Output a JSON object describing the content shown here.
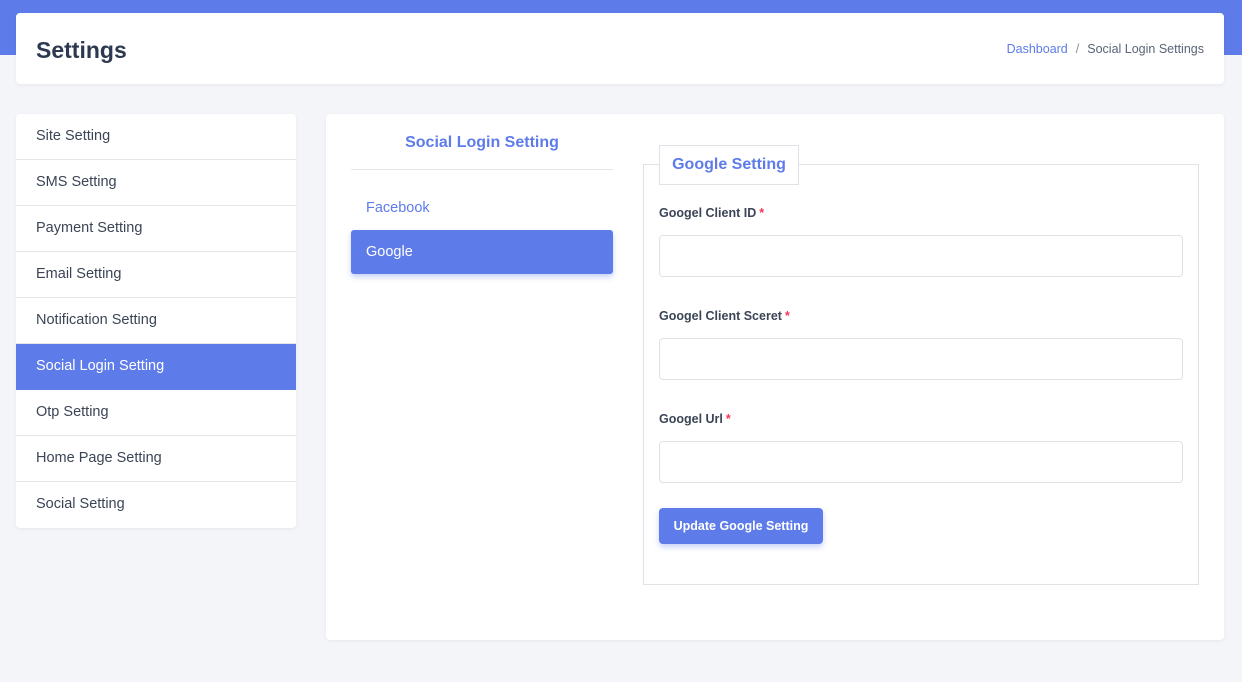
{
  "header": {
    "title": "Settings",
    "breadcrumb": {
      "home": "Dashboard",
      "separator": "/",
      "current": "Social Login Settings"
    }
  },
  "sidebar": {
    "active_index": 5,
    "items": [
      {
        "label": "Site Setting"
      },
      {
        "label": "SMS Setting"
      },
      {
        "label": "Payment Setting"
      },
      {
        "label": "Email Setting"
      },
      {
        "label": "Notification Setting"
      },
      {
        "label": "Social Login Setting"
      },
      {
        "label": "Otp Setting"
      },
      {
        "label": "Home Page Setting"
      },
      {
        "label": "Social Setting"
      }
    ]
  },
  "social_nav": {
    "title": "Social Login Setting",
    "items": [
      {
        "label": "Facebook"
      },
      {
        "label": "Google"
      }
    ],
    "active_index": 1
  },
  "google_form": {
    "legend": "Google Setting",
    "required_mark": "*",
    "fields": [
      {
        "label": "Googel Client ID",
        "value": ""
      },
      {
        "label": "Googel Client Sceret",
        "value": ""
      },
      {
        "label": "Googel Url",
        "value": ""
      }
    ],
    "submit_label": "Update Google Setting"
  },
  "colors": {
    "accent": "#5e7bea",
    "required": "#f5365c",
    "background": "#f4f5f9"
  }
}
